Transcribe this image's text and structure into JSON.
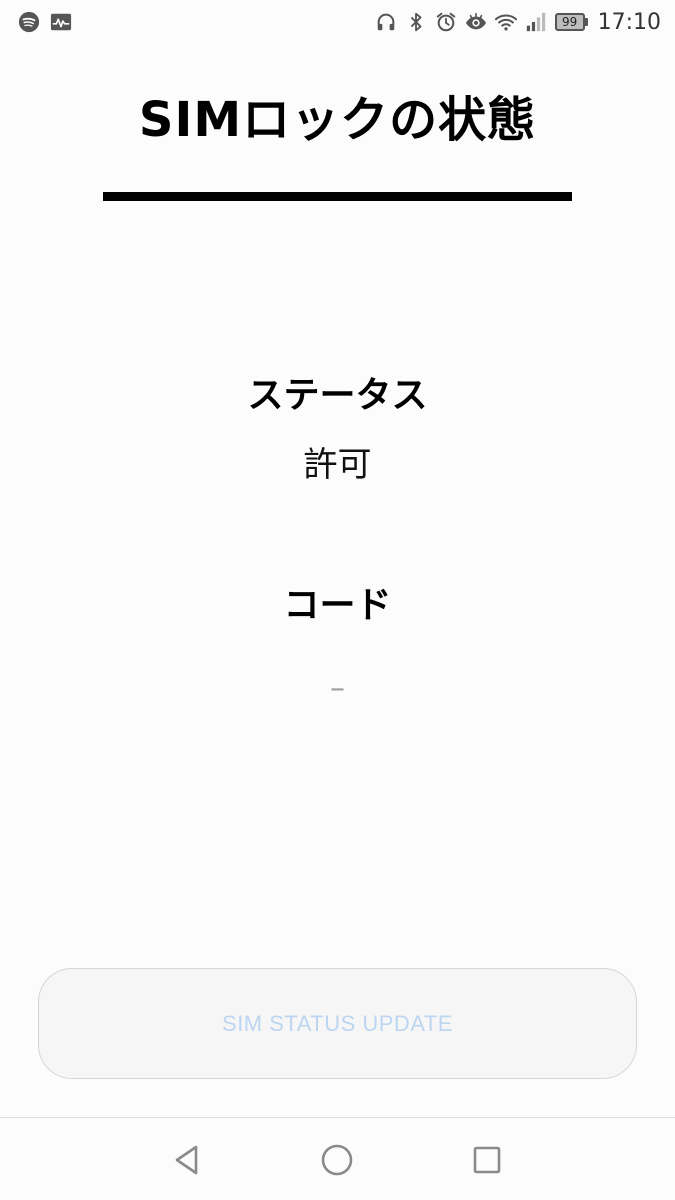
{
  "status_bar": {
    "left_icons": [
      "spotify-icon",
      "activity-monitor-icon"
    ],
    "right_icons": [
      "headphones-icon",
      "bluetooth-icon",
      "alarm-icon",
      "eye-comfort-icon",
      "wifi-icon",
      "cell-signal-icon"
    ],
    "battery_level": "99",
    "time": "17:10"
  },
  "page": {
    "title": "SIMロックの状態"
  },
  "status": {
    "label": "ステータス",
    "value": "許可"
  },
  "code": {
    "label": "コード",
    "value": "–"
  },
  "actions": {
    "update_label": "SIM STATUS UPDATE"
  },
  "nav_bar": {
    "buttons": [
      "back-icon",
      "home-icon",
      "recents-icon"
    ]
  },
  "colors": {
    "background": "#fcfcfc",
    "text": "#000000",
    "button_text_disabled": "#bcd6f1",
    "button_border": "#d6d6d6",
    "nav_icon": "#8a8a8a"
  }
}
